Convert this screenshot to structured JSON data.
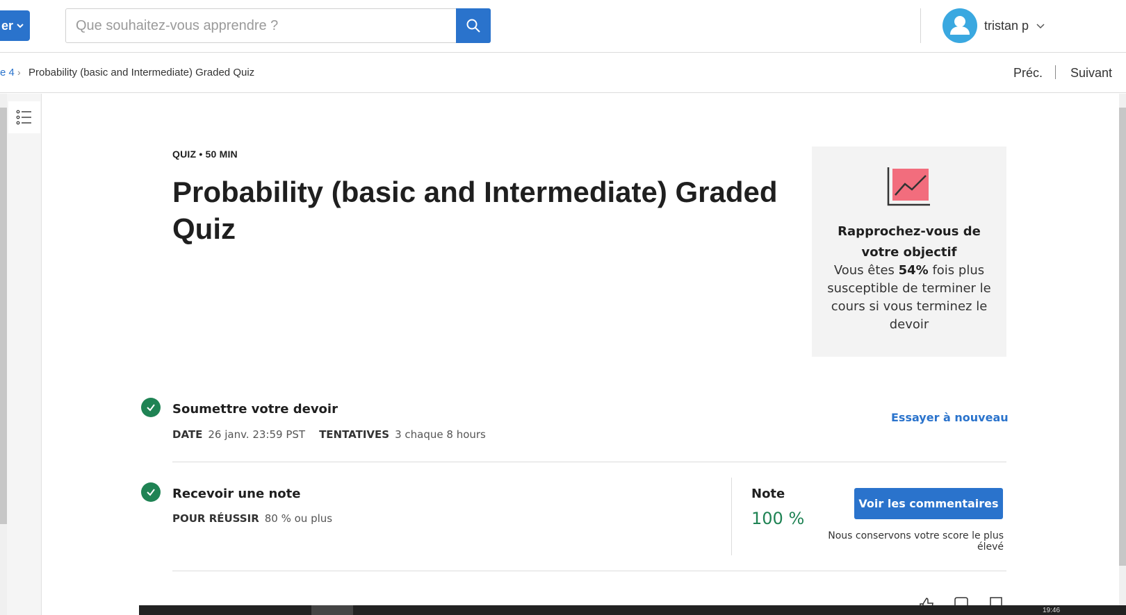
{
  "header": {
    "explore_label": "er",
    "search_placeholder": "Que souhaitez-vous apprendre ?",
    "user_name": "tristan p"
  },
  "breadcrumb": {
    "previous": "e 4",
    "current": "Probability (basic and Intermediate) Graded Quiz",
    "nav_prev": "Préc.",
    "nav_next": "Suivant"
  },
  "quiz": {
    "meta": "QUIZ • 50  MIN",
    "title": "Probability (basic and Intermediate) Graded Quiz"
  },
  "goal_card": {
    "title": "Rapprochez-vous de votre objectif",
    "text_before": "Vous êtes ",
    "highlight": "54%",
    "text_after": " fois plus susceptible de terminer le cours si vous terminez le devoir",
    "icon": "trend-chart-icon",
    "icon_color": "#f26d7d"
  },
  "submit_step": {
    "title": "Soumettre votre devoir",
    "date_label": "DATE",
    "date_value": "26 janv. 23:59 PST",
    "attempts_label": "TENTATIVES",
    "attempts_value": "3 chaque 8  hours",
    "retry_label": "Essayer à nouveau"
  },
  "grade_step": {
    "title": "Recevoir une note",
    "pass_label": "POUR RÉUSSIR",
    "pass_value": "80 % ou plus",
    "grade_label": "Note",
    "grade_value": "100 %",
    "feedback_button": "Voir les commentaires",
    "keep_note": "Nous conservons votre score le plus élevé"
  },
  "taskbar": {
    "time": "19:46"
  },
  "colors": {
    "accent": "#2a73cc",
    "success": "#1f8354",
    "card_bg": "#f3f3f3"
  }
}
